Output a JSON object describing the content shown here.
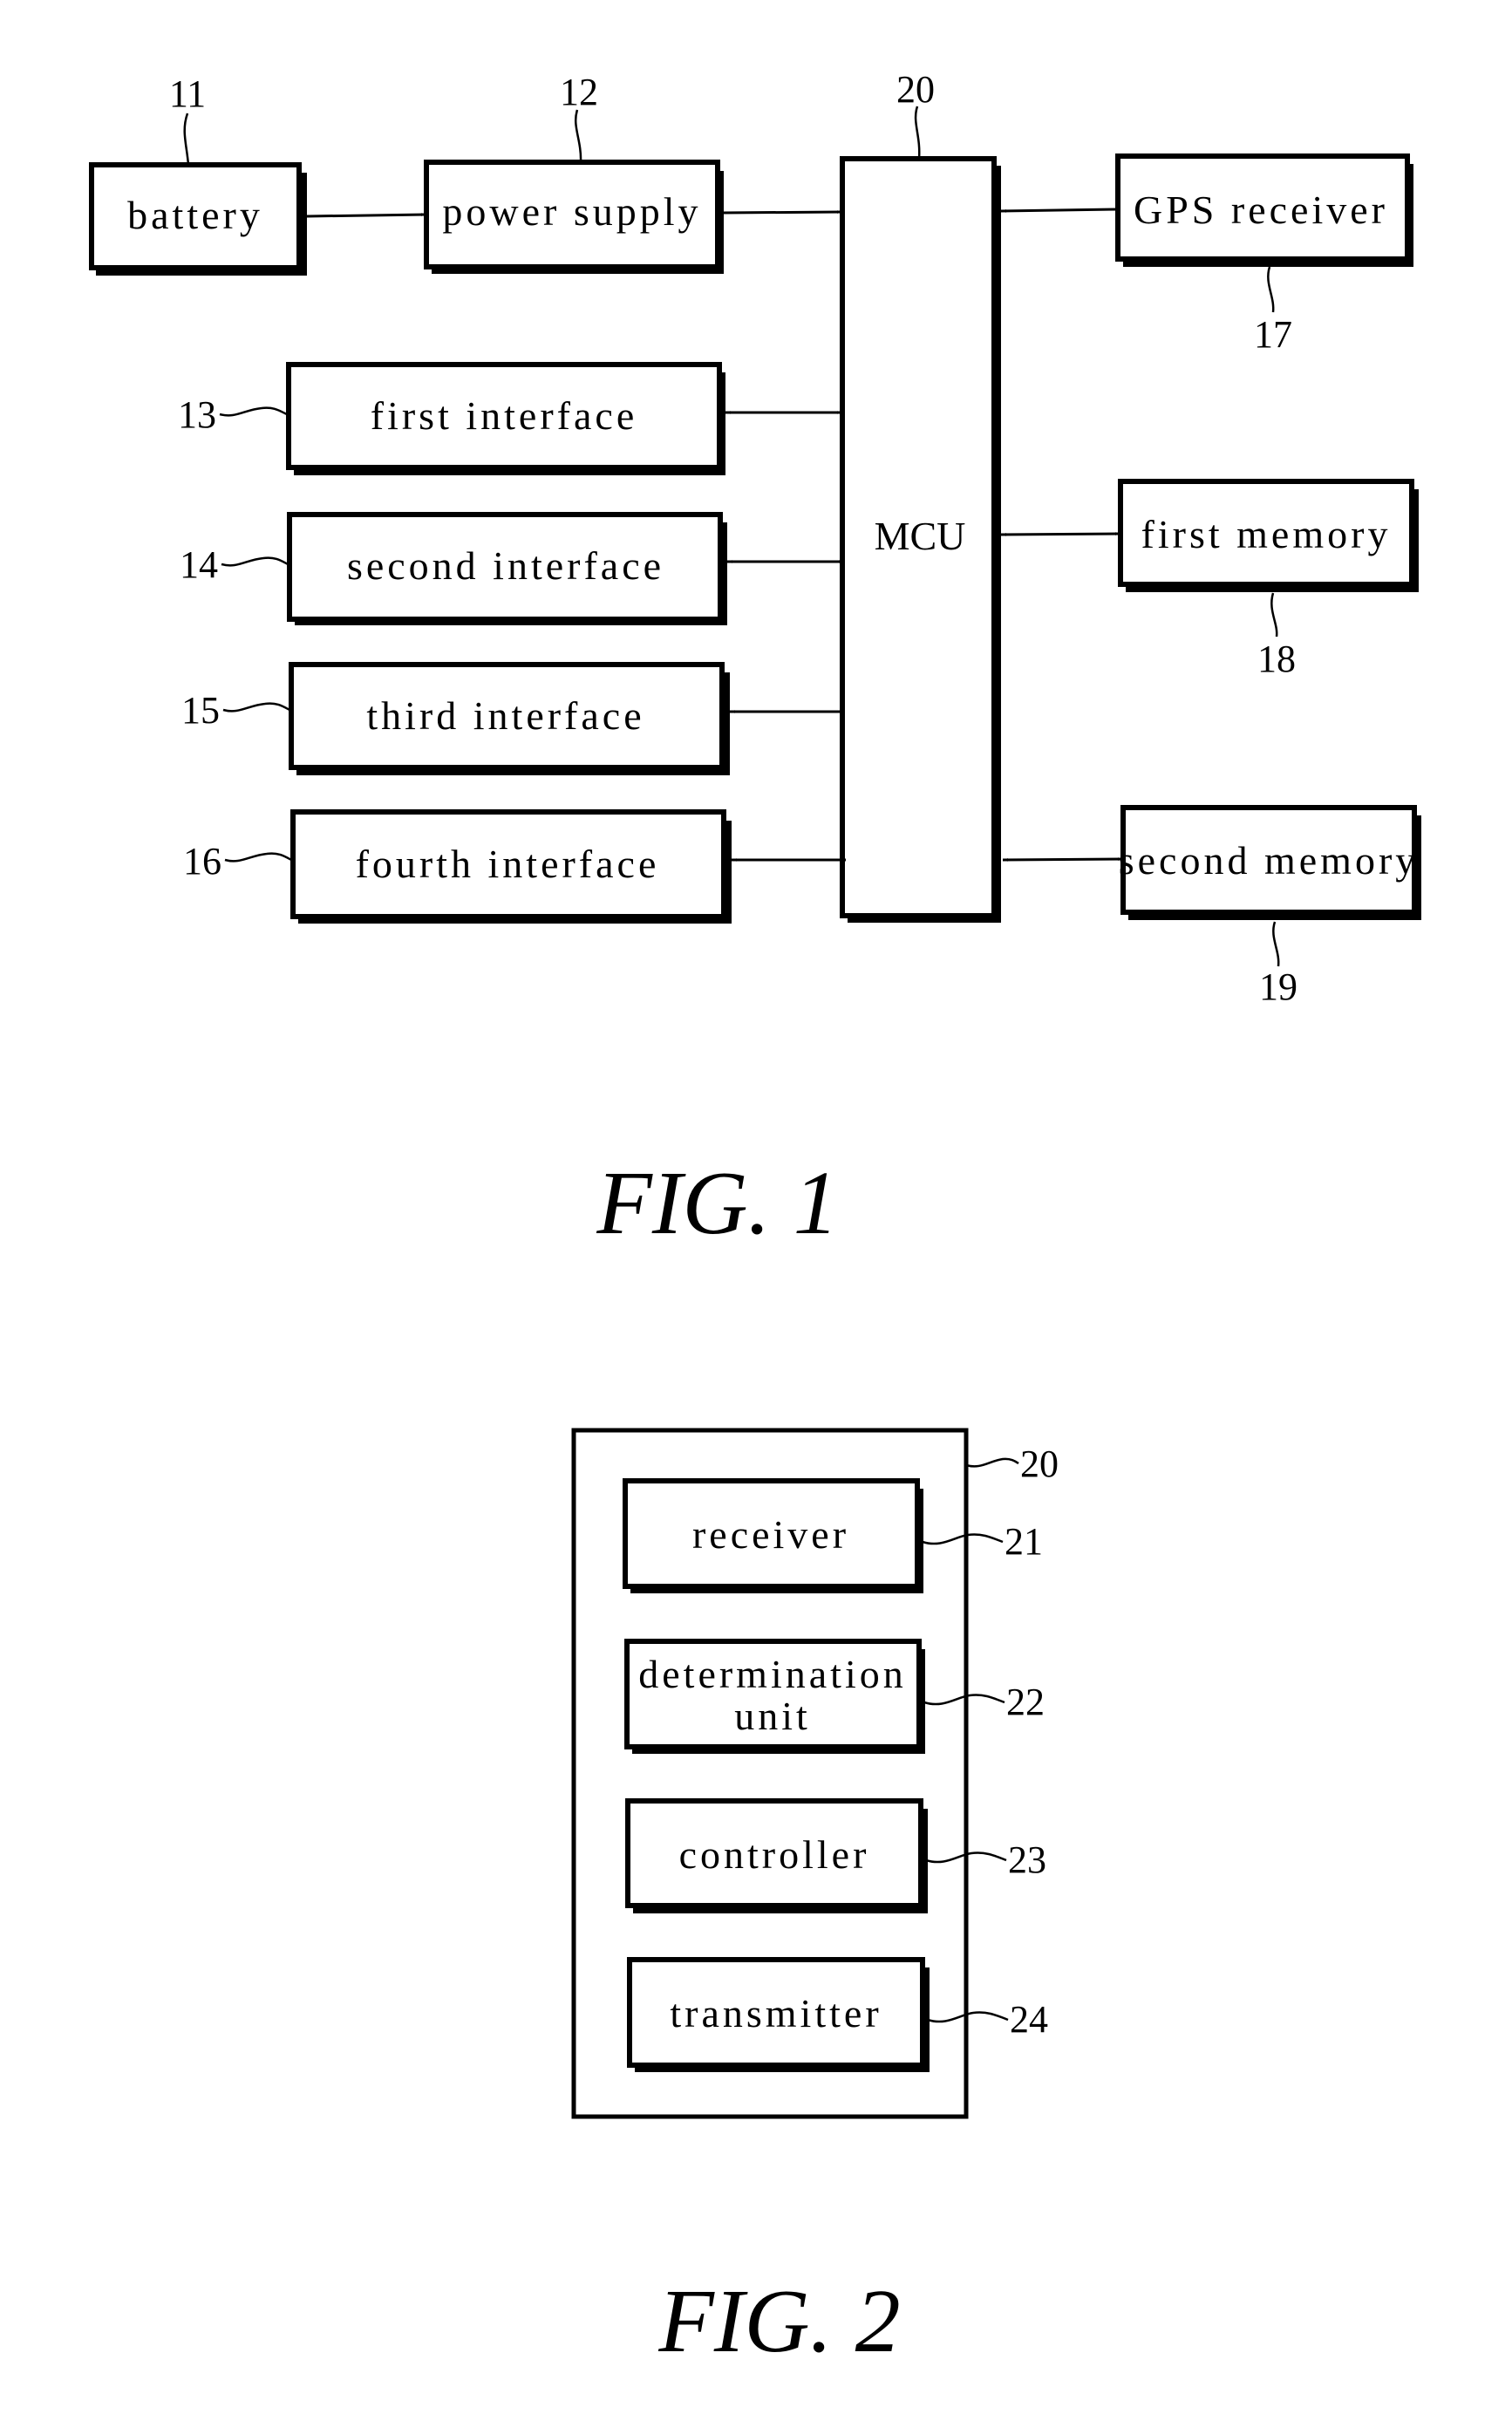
{
  "fig1": {
    "caption": "FIG. 1",
    "blocks": {
      "battery": {
        "label": "battery",
        "ref": "11"
      },
      "power_supply": {
        "label": "power supply",
        "ref": "12"
      },
      "mcu": {
        "label": "MCU",
        "ref": "20"
      },
      "gps_receiver": {
        "label": "GPS receiver",
        "ref": "17"
      },
      "first_interface": {
        "label": "first interface",
        "ref": "13"
      },
      "second_interface": {
        "label": "second interface",
        "ref": "14"
      },
      "third_interface": {
        "label": "third interface",
        "ref": "15"
      },
      "fourth_interface": {
        "label": "fourth interface",
        "ref": "16"
      },
      "first_memory": {
        "label": "first memory",
        "ref": "18"
      },
      "second_memory": {
        "label": "second memory",
        "ref": "19"
      }
    },
    "connections": [
      {
        "from": "battery",
        "to": "power_supply",
        "direction": "one-way"
      },
      {
        "from": "power_supply",
        "to": "mcu",
        "direction": "one-way"
      },
      {
        "from": "gps_receiver",
        "to": "mcu",
        "direction": "one-way"
      },
      {
        "from": "first_interface",
        "to": "mcu",
        "direction": "two-way"
      },
      {
        "from": "second_interface",
        "to": "mcu",
        "direction": "two-way"
      },
      {
        "from": "third_interface",
        "to": "mcu",
        "direction": "two-way"
      },
      {
        "from": "fourth_interface",
        "to": "mcu",
        "direction": "two-way"
      },
      {
        "from": "mcu",
        "to": "first_memory",
        "direction": "two-way"
      },
      {
        "from": "mcu",
        "to": "second_memory",
        "direction": "two-way"
      }
    ]
  },
  "fig2": {
    "caption": "FIG. 2",
    "container": {
      "ref": "20"
    },
    "blocks": {
      "receiver": {
        "label": "receiver",
        "ref": "21"
      },
      "determination_unit": {
        "label_line1": "determination",
        "label_line2": "unit",
        "ref": "22"
      },
      "controller": {
        "label": "controller",
        "ref": "23"
      },
      "transmitter": {
        "label": "transmitter",
        "ref": "24"
      }
    }
  }
}
